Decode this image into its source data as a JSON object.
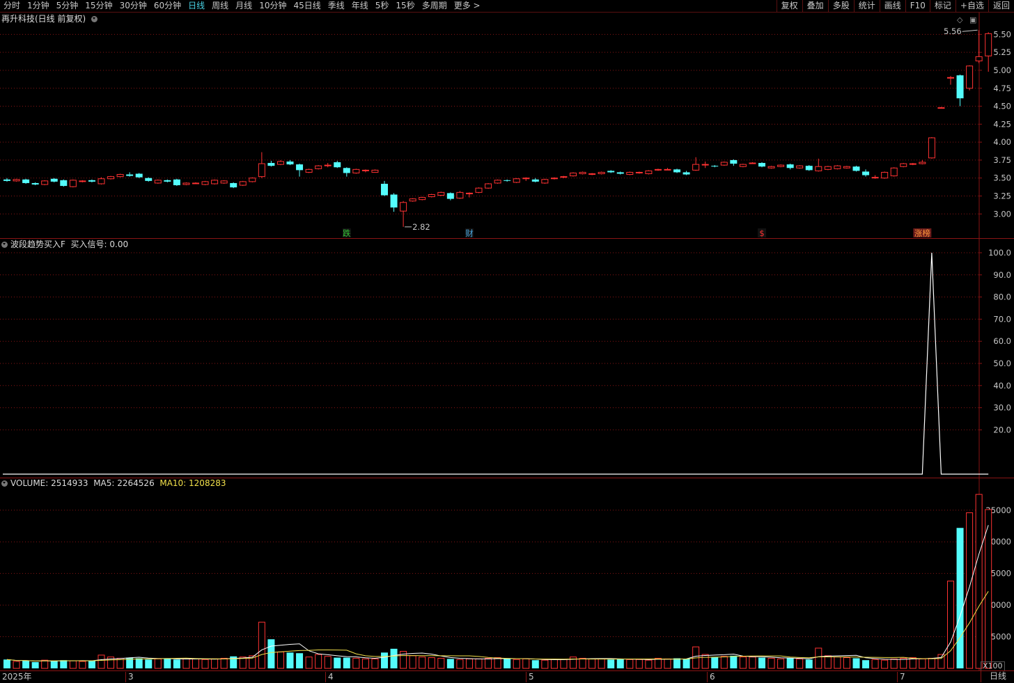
{
  "toolbar": {
    "periods": [
      "分时",
      "1分钟",
      "5分钟",
      "15分钟",
      "30分钟",
      "60分钟",
      "日线",
      "周线",
      "月线",
      "10分钟",
      "45日线",
      "季线",
      "年线",
      "5秒",
      "15秒",
      "多周期",
      "更多 >"
    ],
    "active_period": "日线",
    "right_buttons": [
      "复权",
      "叠加",
      "多股",
      "统计",
      "画线",
      "F10",
      "标记",
      "+自选",
      "返回"
    ]
  },
  "main_panel": {
    "title": "再升科技(日线 前复权)"
  },
  "indicator_panel": {
    "title": "波段趋势买入F",
    "signal_label": "买入信号: 0.00"
  },
  "volume_panel": {
    "volume_label": "VOLUME: 2514933",
    "ma5_label": "MA5: 2264526",
    "ma10_label": "MA10: 1208283"
  },
  "x_axis": {
    "labels": [
      "2025年",
      "3",
      "4",
      "5",
      "6",
      "7"
    ],
    "period_label": "日线",
    "multiplier": "X100"
  },
  "colors": {
    "up": "#ff3232",
    "down": "#54fcfc",
    "grid": "#8a1414",
    "ma5": "#ffffff",
    "ma10": "#f2e04a",
    "signal": "#ffffff"
  },
  "chart_data": [
    {
      "type": "candlestick",
      "title": "再升科技(日线 前复权)",
      "y_ticks": [
        3.0,
        3.25,
        3.5,
        3.75,
        4.0,
        4.25,
        4.5,
        4.75,
        5.0,
        5.25,
        5.5
      ],
      "ylim": [
        2.78,
        5.62
      ],
      "annotations": {
        "high": "5.56",
        "low": "2.82",
        "events": [
          "跌",
          "财",
          "$",
          "涨榜"
        ]
      },
      "candles": [
        [
          3.48,
          3.46,
          3.5,
          3.45
        ],
        [
          3.46,
          3.48,
          3.49,
          3.45
        ],
        [
          3.48,
          3.43,
          3.49,
          3.42
        ],
        [
          3.43,
          3.41,
          3.44,
          3.4
        ],
        [
          3.41,
          3.46,
          3.47,
          3.4
        ],
        [
          3.49,
          3.45,
          3.5,
          3.44
        ],
        [
          3.47,
          3.39,
          3.48,
          3.38
        ],
        [
          3.38,
          3.47,
          3.48,
          3.37
        ],
        [
          3.45,
          3.46,
          3.47,
          3.44
        ],
        [
          3.47,
          3.45,
          3.48,
          3.44
        ],
        [
          3.42,
          3.49,
          3.51,
          3.41
        ],
        [
          3.49,
          3.52,
          3.53,
          3.48
        ],
        [
          3.52,
          3.55,
          3.56,
          3.51
        ],
        [
          3.55,
          3.53,
          3.58,
          3.52
        ],
        [
          3.56,
          3.51,
          3.57,
          3.5
        ],
        [
          3.5,
          3.46,
          3.51,
          3.45
        ],
        [
          3.43,
          3.47,
          3.48,
          3.42
        ],
        [
          3.47,
          3.45,
          3.48,
          3.44
        ],
        [
          3.48,
          3.4,
          3.49,
          3.39
        ],
        [
          3.41,
          3.43,
          3.44,
          3.4
        ],
        [
          3.43,
          3.43,
          3.44,
          3.42
        ],
        [
          3.41,
          3.45,
          3.46,
          3.4
        ],
        [
          3.42,
          3.47,
          3.48,
          3.41
        ],
        [
          3.43,
          3.46,
          3.47,
          3.42
        ],
        [
          3.43,
          3.37,
          3.44,
          3.36
        ],
        [
          3.4,
          3.45,
          3.46,
          3.39
        ],
        [
          3.45,
          3.5,
          3.51,
          3.44
        ],
        [
          3.52,
          3.7,
          3.86,
          3.5
        ],
        [
          3.71,
          3.67,
          3.74,
          3.66
        ],
        [
          3.69,
          3.73,
          3.75,
          3.68
        ],
        [
          3.73,
          3.69,
          3.75,
          3.68
        ],
        [
          3.69,
          3.61,
          3.7,
          3.52
        ],
        [
          3.58,
          3.62,
          3.63,
          3.57
        ],
        [
          3.63,
          3.67,
          3.68,
          3.62
        ],
        [
          3.67,
          3.68,
          3.71,
          3.65
        ],
        [
          3.72,
          3.65,
          3.74,
          3.64
        ],
        [
          3.64,
          3.57,
          3.65,
          3.52
        ],
        [
          3.57,
          3.62,
          3.63,
          3.56
        ],
        [
          3.6,
          3.61,
          3.62,
          3.58
        ],
        [
          3.58,
          3.61,
          3.62,
          3.58
        ],
        [
          3.42,
          3.26,
          3.46,
          3.25
        ],
        [
          3.27,
          3.09,
          3.29,
          3.03
        ],
        [
          3.04,
          3.16,
          3.18,
          2.82
        ],
        [
          3.18,
          3.21,
          3.22,
          3.17
        ],
        [
          3.2,
          3.23,
          3.24,
          3.19
        ],
        [
          3.24,
          3.27,
          3.28,
          3.23
        ],
        [
          3.26,
          3.3,
          3.31,
          3.25
        ],
        [
          3.29,
          3.21,
          3.3,
          3.19
        ],
        [
          3.22,
          3.3,
          3.32,
          3.21
        ],
        [
          3.28,
          3.29,
          3.3,
          3.23
        ],
        [
          3.3,
          3.36,
          3.37,
          3.29
        ],
        [
          3.36,
          3.42,
          3.43,
          3.35
        ],
        [
          3.43,
          3.47,
          3.48,
          3.42
        ],
        [
          3.47,
          3.46,
          3.48,
          3.45
        ],
        [
          3.44,
          3.49,
          3.5,
          3.43
        ],
        [
          3.49,
          3.5,
          3.51,
          3.46
        ],
        [
          3.48,
          3.45,
          3.5,
          3.44
        ],
        [
          3.43,
          3.48,
          3.49,
          3.42
        ],
        [
          3.49,
          3.5,
          3.51,
          3.48
        ],
        [
          3.51,
          3.52,
          3.53,
          3.5
        ],
        [
          3.53,
          3.57,
          3.58,
          3.52
        ],
        [
          3.56,
          3.58,
          3.59,
          3.55
        ],
        [
          3.56,
          3.56,
          3.57,
          3.54
        ],
        [
          3.56,
          3.58,
          3.59,
          3.55
        ],
        [
          3.6,
          3.58,
          3.61,
          3.57
        ],
        [
          3.58,
          3.56,
          3.59,
          3.55
        ],
        [
          3.55,
          3.58,
          3.59,
          3.54
        ],
        [
          3.57,
          3.58,
          3.59,
          3.56
        ],
        [
          3.56,
          3.6,
          3.61,
          3.55
        ],
        [
          3.61,
          3.62,
          3.63,
          3.6
        ],
        [
          3.62,
          3.62,
          3.64,
          3.61
        ],
        [
          3.62,
          3.58,
          3.63,
          3.57
        ],
        [
          3.58,
          3.55,
          3.6,
          3.54
        ],
        [
          3.61,
          3.69,
          3.79,
          3.6
        ],
        [
          3.69,
          3.69,
          3.73,
          3.64
        ],
        [
          3.67,
          3.66,
          3.68,
          3.65
        ],
        [
          3.68,
          3.72,
          3.73,
          3.67
        ],
        [
          3.75,
          3.7,
          3.76,
          3.67
        ],
        [
          3.66,
          3.69,
          3.7,
          3.65
        ],
        [
          3.7,
          3.71,
          3.72,
          3.7
        ],
        [
          3.71,
          3.66,
          3.72,
          3.65
        ],
        [
          3.64,
          3.66,
          3.67,
          3.63
        ],
        [
          3.66,
          3.68,
          3.69,
          3.65
        ],
        [
          3.69,
          3.64,
          3.7,
          3.62
        ],
        [
          3.64,
          3.67,
          3.68,
          3.63
        ],
        [
          3.67,
          3.61,
          3.68,
          3.6
        ],
        [
          3.6,
          3.66,
          3.77,
          3.59
        ],
        [
          3.62,
          3.66,
          3.67,
          3.61
        ],
        [
          3.63,
          3.67,
          3.68,
          3.62
        ],
        [
          3.64,
          3.66,
          3.67,
          3.63
        ],
        [
          3.66,
          3.6,
          3.67,
          3.59
        ],
        [
          3.59,
          3.54,
          3.62,
          3.52
        ],
        [
          3.51,
          3.51,
          3.54,
          3.49
        ],
        [
          3.5,
          3.58,
          3.59,
          3.49
        ],
        [
          3.53,
          3.64,
          3.65,
          3.52
        ],
        [
          3.66,
          3.7,
          3.71,
          3.65
        ],
        [
          3.69,
          3.7,
          3.71,
          3.68
        ],
        [
          3.7,
          3.72,
          3.75,
          3.69
        ],
        [
          3.78,
          4.06,
          4.07,
          3.77
        ],
        [
          4.47,
          4.48,
          4.49,
          4.47
        ],
        [
          4.9,
          4.9,
          4.92,
          4.8
        ],
        [
          4.93,
          4.61,
          4.94,
          4.5
        ],
        [
          4.75,
          5.06,
          5.07,
          4.72
        ],
        [
          5.13,
          5.19,
          5.56,
          5.1
        ],
        [
          5.2,
          5.51,
          5.53,
          4.98
        ]
      ]
    },
    {
      "type": "line",
      "title": "波段趋势买入F",
      "y_ticks": [
        20,
        30,
        40,
        50,
        60,
        70,
        80,
        90,
        100
      ],
      "ylim": [
        0,
        100
      ],
      "series": [
        {
          "name": "买入信号",
          "values": []
        }
      ],
      "spike": {
        "index": 98,
        "value": 100
      }
    },
    {
      "type": "bar",
      "title": "VOLUME",
      "unit": "X100",
      "y_ticks": [
        5000,
        10000,
        15000,
        20000,
        25000
      ],
      "ylim": [
        0,
        28500
      ],
      "volumes": [
        1400,
        1100,
        1200,
        1000,
        1300,
        1200,
        1300,
        1200,
        1100,
        1200,
        2100,
        1800,
        1600,
        1700,
        1600,
        1400,
        1500,
        1600,
        1400,
        1500,
        1500,
        1400,
        1500,
        1600,
        1900,
        1800,
        2000,
        7300,
        4600,
        2600,
        2500,
        2400,
        1800,
        2200,
        1900,
        1700,
        1700,
        1600,
        1500,
        1500,
        2500,
        3100,
        2700,
        2000,
        1800,
        1700,
        1600,
        1500,
        1400,
        1500,
        1500,
        1600,
        1700,
        1500,
        1400,
        1500,
        1300,
        1300,
        1400,
        1400,
        1800,
        1600,
        1500,
        1500,
        1400,
        1500,
        1400,
        1400,
        1300,
        1600,
        1500,
        1600,
        1500,
        3400,
        2200,
        1800,
        1900,
        2000,
        1800,
        1800,
        1700,
        1600,
        1500,
        1600,
        1500,
        1400,
        3200,
        2000,
        1800,
        1700,
        1600,
        1300,
        1400,
        1300,
        1500,
        1600,
        1700,
        1500,
        1600,
        2200,
        13800,
        22200,
        24600,
        27500,
        25100
      ]
    }
  ]
}
